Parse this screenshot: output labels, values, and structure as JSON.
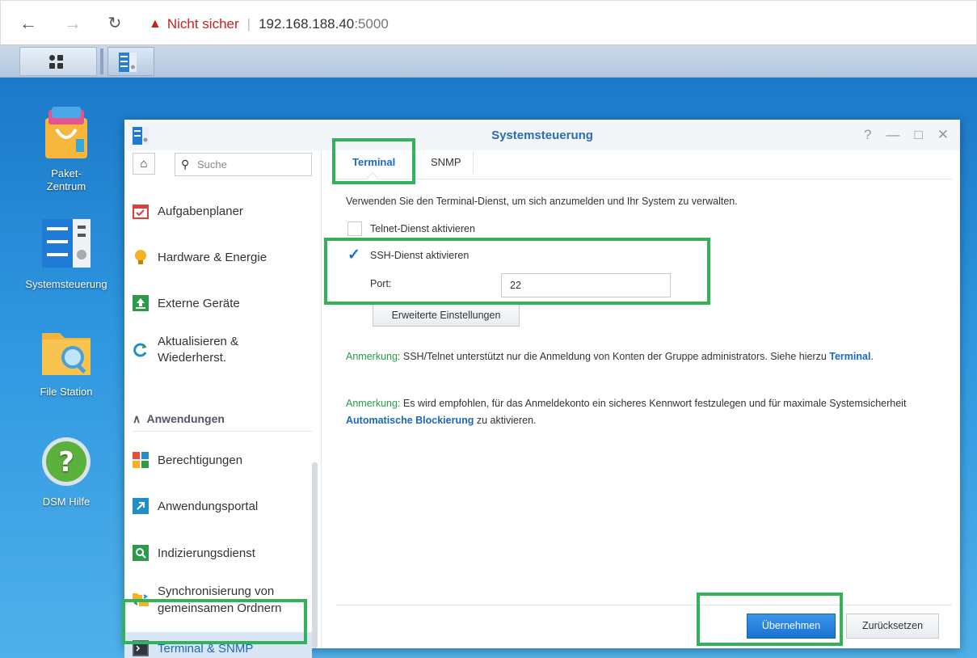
{
  "browser": {
    "not_secure": "Nicht sicher",
    "host": "192.168.188.40",
    "port": ":5000"
  },
  "desktop_icons": [
    {
      "label": "Paket-\nZentrum",
      "icon": "package-center-icon"
    },
    {
      "label": "Systemsteuerung",
      "icon": "control-panel-icon"
    },
    {
      "label": "File Station",
      "icon": "folder-search-icon"
    },
    {
      "label": "DSM Hilfe",
      "icon": "help-icon"
    }
  ],
  "window": {
    "title": "Systemsteuerung",
    "controls": [
      "?",
      "—",
      "□",
      "✕"
    ]
  },
  "sidebar": {
    "search_placeholder": "Suche",
    "items": [
      {
        "label": "Aufgabenplaner",
        "icon": "calendar-icon"
      },
      {
        "label": "Hardware & Energie",
        "icon": "lightbulb-icon"
      },
      {
        "label": "Externe Geräte",
        "icon": "upload-icon"
      },
      {
        "label": "Aktualisieren & Wiederherst.",
        "icon": "refresh-icon"
      }
    ],
    "section": "Anwendungen",
    "app_items": [
      {
        "label": "Berechtigungen",
        "icon": "permissions-icon"
      },
      {
        "label": "Anwendungsportal",
        "icon": "portal-icon"
      },
      {
        "label": "Indizierungsdienst",
        "icon": "index-icon"
      },
      {
        "label": "Synchronisierung von gemeinsamen Ordnern",
        "icon": "sync-folder-icon"
      },
      {
        "label": "Terminal & SNMP",
        "icon": "terminal-icon"
      }
    ]
  },
  "tabs": [
    "Terminal",
    "SNMP"
  ],
  "content": {
    "description": "Verwenden Sie den Terminal-Dienst, um sich anzumelden und Ihr System zu verwalten.",
    "telnet_label": "Telnet-Dienst aktivieren",
    "telnet_checked": false,
    "ssh_label": "SSH-Dienst aktivieren",
    "ssh_checked": true,
    "port_label": "Port:",
    "port_value": "22",
    "advanced_button": "Erweiterte Einstellungen",
    "note_label": "Anmerkung:",
    "note1_text": " SSH/Telnet unterstützt nur die Anmeldung von Konten der Gruppe administrators. Siehe hierzu ",
    "note1_link": "Terminal",
    "note1_end": ".",
    "note2_text": " Es wird empfohlen, für das Anmeldekonto ein sicheres Kennwort festzulegen und für maximale Systemsicherheit ",
    "note2_link": "Automatische Blockierung",
    "note2_end": " zu aktivieren."
  },
  "buttons": {
    "apply": "Übernehmen",
    "reset": "Zurücksetzen"
  },
  "colors": {
    "accent": "#1a69c1",
    "highlight": "#32b35a",
    "note_label": "#259b4b",
    "warning": "#c5221f"
  }
}
